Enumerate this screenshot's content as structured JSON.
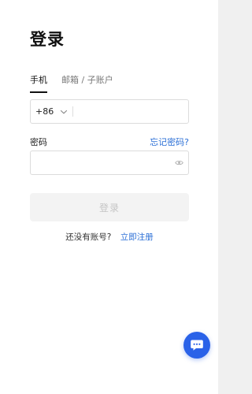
{
  "page": {
    "title": "登录"
  },
  "tabs": [
    {
      "label": "手机",
      "active": true
    },
    {
      "label": "邮箱 / 子账户",
      "active": false
    }
  ],
  "phone": {
    "country_code": "+86",
    "value": "",
    "placeholder": ""
  },
  "password": {
    "label": "密码",
    "forgot_label": "忘记密码?",
    "value": "",
    "placeholder": ""
  },
  "login": {
    "button_label": "登录",
    "enabled": false
  },
  "register": {
    "question": "还没有账号?",
    "link_label": "立即注册"
  },
  "icons": {
    "country_dropdown": "chevron-down-icon",
    "password_visibility": "eye-icon",
    "chat": "chat-icon"
  },
  "colors": {
    "accent": "#2b6fd6",
    "chat_button": "#2a62e8",
    "disabled_button_bg": "#f3f3f3",
    "disabled_button_text": "#c4c4c4"
  }
}
